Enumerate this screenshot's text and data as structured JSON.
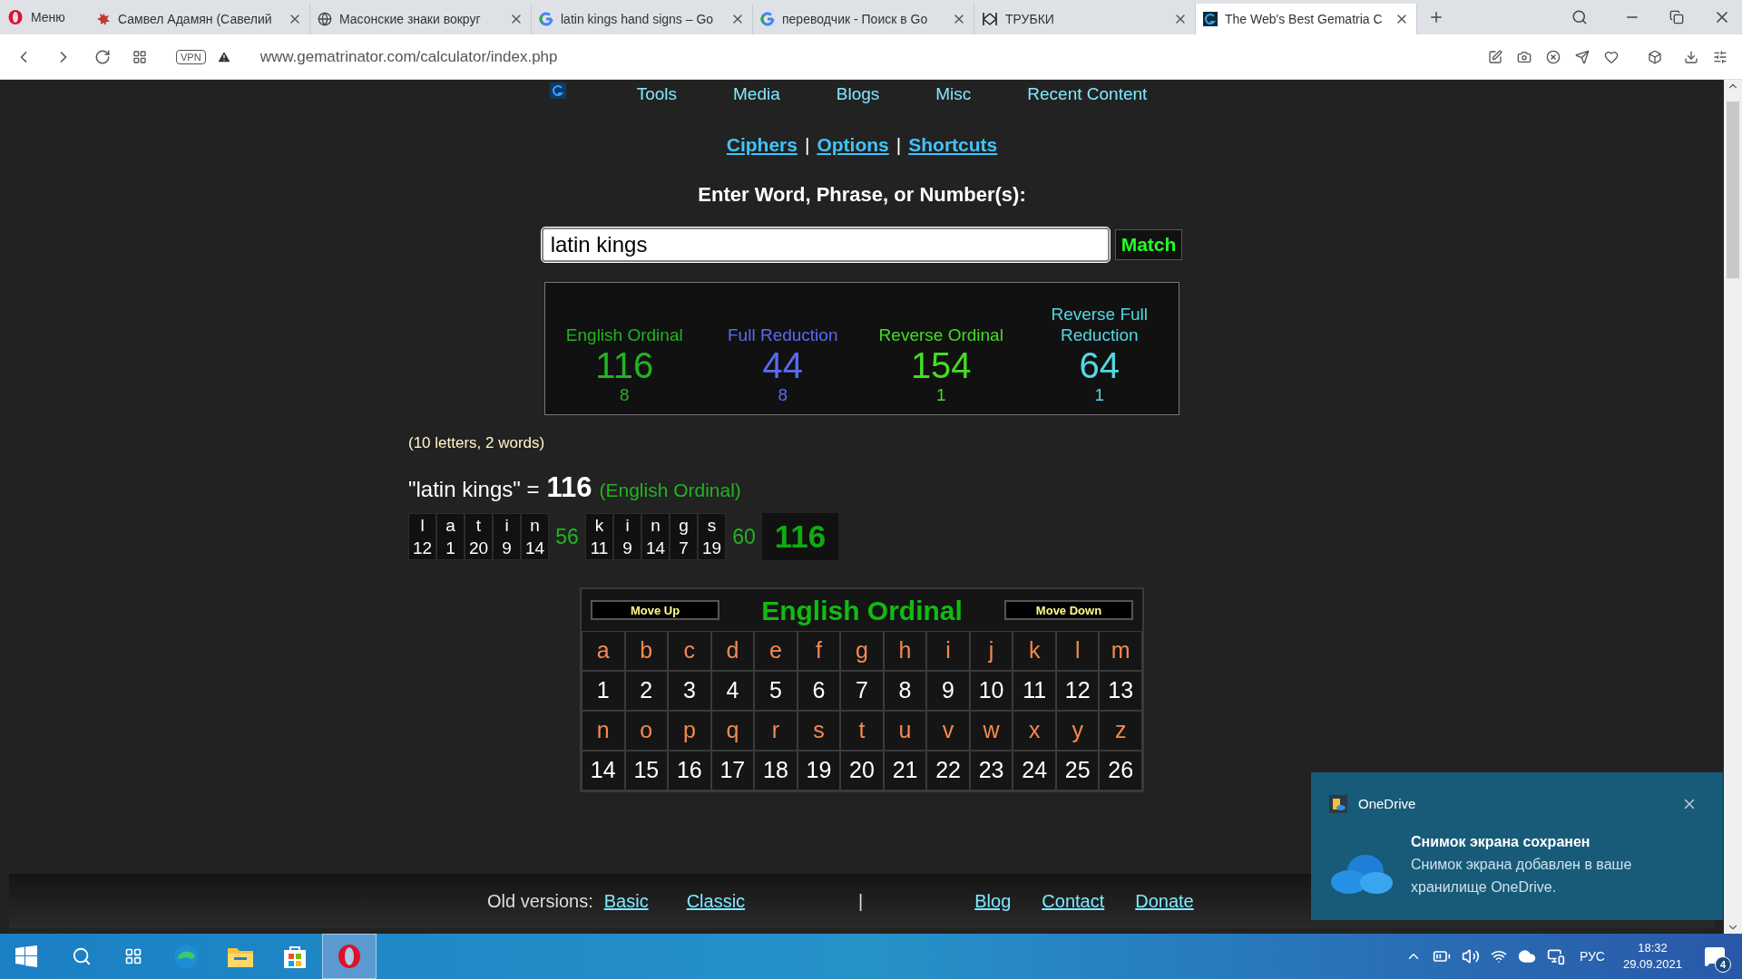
{
  "browser": {
    "menu_label": "Меню",
    "tabs": [
      {
        "kind": "splat",
        "title": "Самвел Адамян (Савелий",
        "selected": false
      },
      {
        "kind": "globe",
        "title": "Масонские знаки вокруг",
        "selected": false
      },
      {
        "kind": "ring",
        "title": "latin kings hand signs – Go",
        "selected": false
      },
      {
        "kind": "ring",
        "title": "переводчик - Поиск в Go",
        "selected": false
      },
      {
        "kind": "mark",
        "title": "ТРУБКИ",
        "selected": false
      },
      {
        "kind": "site",
        "title": "The Web's Best Gematria C",
        "selected": true
      }
    ],
    "vpn": "VPN",
    "address": "www.gematrinator.com/calculator/index.php"
  },
  "nav": {
    "items": [
      "Tools",
      "Media",
      "Blogs",
      "Misc",
      "Recent Content"
    ]
  },
  "links": {
    "items": [
      "Ciphers",
      "Options",
      "Shortcuts"
    ],
    "separator": "|"
  },
  "prompt": "Enter Word, Phrase, or Number(s):",
  "search": {
    "value": "latin kings",
    "button": "Match"
  },
  "summary": [
    {
      "name": "English Ordinal",
      "value": "116",
      "reduction": "8",
      "color": "#22b322"
    },
    {
      "name": "Full Reduction",
      "value": "44",
      "reduction": "8",
      "color": "#5a6cf0"
    },
    {
      "name": "Reverse Ordinal",
      "value": "154",
      "reduction": "1",
      "color": "#44dd22"
    },
    {
      "name": "Reverse Full Reduction",
      "value": "64",
      "reduction": "1",
      "color": "#55d8e0"
    }
  ],
  "counts": "(10 letters, 2 words)",
  "equation": {
    "phrase": "\"latin kings\" =",
    "total": "116",
    "cipher": "(English Ordinal)"
  },
  "breakdown": {
    "words": [
      {
        "letters": [
          [
            "l",
            "12"
          ],
          [
            "a",
            "1"
          ],
          [
            "t",
            "20"
          ],
          [
            "i",
            "9"
          ],
          [
            "n",
            "14"
          ]
        ],
        "sum": "56"
      },
      {
        "letters": [
          [
            "k",
            "11"
          ],
          [
            "i",
            "9"
          ],
          [
            "n",
            "14"
          ],
          [
            "g",
            "7"
          ],
          [
            "s",
            "19"
          ]
        ],
        "sum": "60"
      }
    ],
    "total": "116"
  },
  "cipher_table": {
    "move_up": "Move Up",
    "title": "English Ordinal",
    "move_down": "Move Down",
    "rows": [
      [
        "a",
        "b",
        "c",
        "d",
        "e",
        "f",
        "g",
        "h",
        "i",
        "j",
        "k",
        "l",
        "m"
      ],
      [
        "1",
        "2",
        "3",
        "4",
        "5",
        "6",
        "7",
        "8",
        "9",
        "10",
        "11",
        "12",
        "13"
      ],
      [
        "n",
        "o",
        "p",
        "q",
        "r",
        "s",
        "t",
        "u",
        "v",
        "w",
        "x",
        "y",
        "z"
      ],
      [
        "14",
        "15",
        "16",
        "17",
        "18",
        "19",
        "20",
        "21",
        "22",
        "23",
        "24",
        "25",
        "26"
      ]
    ]
  },
  "footer": {
    "label": "Old versions:",
    "old_links": [
      "Basic",
      "Classic"
    ],
    "separator": "|",
    "links": [
      "Blog",
      "Contact",
      "Donate"
    ]
  },
  "toast": {
    "app": "OneDrive",
    "title": "Снимок экрана сохранен",
    "body": "Снимок экрана добавлен в ваше хранилище OneDrive."
  },
  "taskbar": {
    "apps": [
      {
        "kind": "edge",
        "selected": false
      },
      {
        "kind": "folder",
        "selected": false
      },
      {
        "kind": "store",
        "selected": false
      },
      {
        "kind": "opera",
        "selected": true
      }
    ],
    "language": "РУС",
    "time": "18:32",
    "date": "29.09.2021",
    "notifications": "4"
  }
}
